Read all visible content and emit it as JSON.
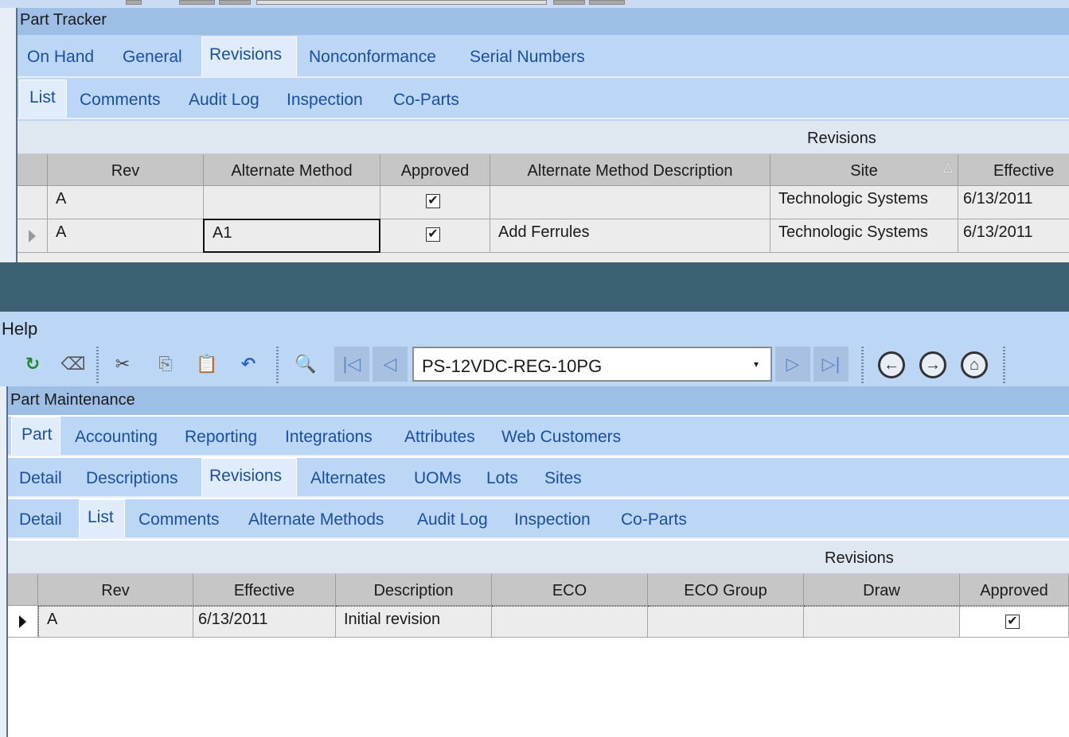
{
  "top": {
    "title": "Part Tracker",
    "tabs1": [
      "On Hand",
      "General",
      "Revisions",
      "Nonconformance",
      "Serial Numbers"
    ],
    "tabs2": [
      "List",
      "Comments",
      "Audit Log",
      "Inspection",
      "Co-Parts"
    ],
    "grid_caption": "Revisions",
    "columns": [
      "Rev",
      "Alternate Method",
      "Approved",
      "Alternate Method Description",
      "Site",
      "Effective"
    ],
    "rows": [
      {
        "rev": "A",
        "alt_method": "",
        "approved": "✔",
        "alt_desc": "",
        "site": "Technologic Systems",
        "effective": "6/13/2011"
      },
      {
        "rev": "A",
        "alt_method": "A1",
        "approved": "✔",
        "alt_desc": "Add Ferrules",
        "site": "Technologic Systems",
        "effective": "6/13/2011"
      }
    ]
  },
  "bottom": {
    "menu_help": "Help",
    "part_number": "PS-12VDC-REG-10PG",
    "title": "Part Maintenance",
    "tabs1": [
      "Part",
      "Accounting",
      "Reporting",
      "Integrations",
      "Attributes",
      "Web Customers"
    ],
    "tabs2": [
      "Detail",
      "Descriptions",
      "Revisions",
      "Alternates",
      "UOMs",
      "Lots",
      "Sites"
    ],
    "tabs3": [
      "Detail",
      "List",
      "Comments",
      "Alternate Methods",
      "Audit Log",
      "Inspection",
      "Co-Parts"
    ],
    "grid_caption": "Revisions",
    "columns": [
      "Rev",
      "Effective",
      "Description",
      "ECO",
      "ECO Group",
      "Draw",
      "Approved"
    ],
    "rows": [
      {
        "rev": "A",
        "effective": "6/13/2011",
        "description": "Initial revision",
        "eco": "",
        "eco_group": "",
        "draw": "",
        "approved": "✔"
      }
    ]
  },
  "icons": {
    "refresh": "↻",
    "eraser": "⌫",
    "cut": "✂",
    "copy": "⎘",
    "paste": "📋",
    "undo": "↶",
    "find": "🔍",
    "first": "|◁",
    "prev": "◁",
    "next": "▷",
    "last": "▷|",
    "back": "←",
    "forward": "→",
    "home": "⌂",
    "dropdown": "▾",
    "sort_asc": "△"
  },
  "colors": {
    "panel": "#bcd6f5",
    "title_bar": "#9dbfe6",
    "tab_text": "#1b4fa0",
    "gap": "#3b6173",
    "grid_header": "#c6c6c6"
  }
}
